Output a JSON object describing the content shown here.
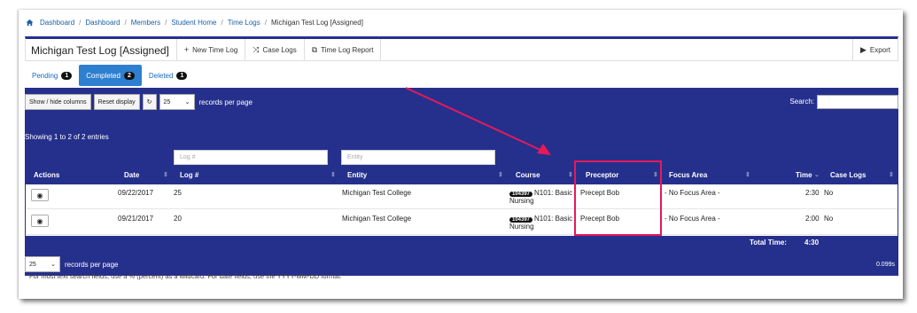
{
  "breadcrumb": {
    "items": [
      "Dashboard",
      "Dashboard",
      "Members",
      "Student Home",
      "Time Logs"
    ],
    "current": "Michigan Test Log [Assigned]",
    "separator": "/"
  },
  "header": {
    "title": "Michigan Test Log [Assigned]",
    "new_time_log": "New Time Log",
    "case_logs": "Case Logs",
    "time_log_report": "Time Log Report",
    "export": "Export"
  },
  "tabs": [
    {
      "label": "Pending",
      "count": "1"
    },
    {
      "label": "Completed",
      "count": "2"
    },
    {
      "label": "Deleted",
      "count": "1"
    }
  ],
  "controls": {
    "show_hide": "Show / hide columns",
    "reset_display": "Reset display",
    "per_page_value": "25",
    "per_page_label": "records per page",
    "search_label": "Search:",
    "showing": "Showing 1 to 2 of 2 entries",
    "timing": "0.099s"
  },
  "filters": {
    "log_placeholder": "Log #",
    "entity_placeholder": "Entity"
  },
  "columns": [
    "Actions",
    "Date",
    "Log #",
    "Entity",
    "Course",
    "Preceptor",
    "Focus Area",
    "Time",
    "Case Logs"
  ],
  "rows": [
    {
      "date": "09/22/2017",
      "log": "25",
      "entity": "Michigan Test College",
      "course_badge": "104397",
      "course_a": "N101: Basic",
      "course_b": "Nursing",
      "preceptor": "Precept Bob",
      "focus": "- No Focus Area -",
      "time": "2:30",
      "case_logs": "No"
    },
    {
      "date": "09/21/2017",
      "log": "20",
      "entity": "Michigan Test College",
      "course_badge": "104397",
      "course_a": "N101: Basic",
      "course_b": "Nursing",
      "preceptor": "Precept Bob",
      "focus": "- No Focus Area -",
      "time": "2:00",
      "case_logs": "No"
    }
  ],
  "totals": {
    "label": "Total Time:",
    "value": "4:30"
  },
  "footnote": "For most text search fields, use a % (percent) as a wildcard. For date fields, use the YYYY-MM-DD format.",
  "colors": {
    "navy": "#25308c",
    "tab_active": "#2f7fd1",
    "highlight": "#e6195a"
  }
}
